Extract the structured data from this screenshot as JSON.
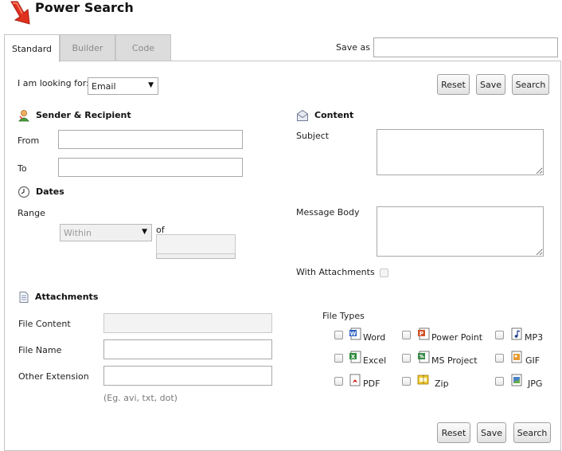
{
  "header": {
    "title": "Power Search"
  },
  "tabs": [
    {
      "label": "Standard",
      "active": true
    },
    {
      "label": "Builder",
      "active": false
    },
    {
      "label": "Code",
      "active": false
    }
  ],
  "save_as": {
    "label": "Save as",
    "value": ""
  },
  "looking_for": {
    "label": "I am looking for:",
    "selected": "Email"
  },
  "buttons": {
    "reset": "Reset",
    "save": "Save",
    "search": "Search"
  },
  "sender": {
    "title": "Sender & Recipient",
    "from_label": "From",
    "to_label": "To",
    "from_value": "",
    "to_value": ""
  },
  "dates": {
    "title": "Dates",
    "range_label": "Range",
    "range_selected": "Within",
    "unit_selected": "",
    "of_label": "of",
    "of_value": ""
  },
  "content": {
    "title": "Content",
    "subject_label": "Subject",
    "body_label": "Message Body",
    "attachments_label": "With Attachments"
  },
  "attachments": {
    "title": "Attachments",
    "file_content_label": "File Content",
    "file_name_label": "File Name",
    "other_ext_label": "Other Extension",
    "hint": "(Eg. avi, txt, dot)"
  },
  "file_types": {
    "title": "File Types",
    "items": [
      {
        "label": "Word",
        "icon": "word-icon"
      },
      {
        "label": "Power Point",
        "icon": "powerpoint-icon"
      },
      {
        "label": "MP3",
        "icon": "mp3-icon"
      },
      {
        "label": "Excel",
        "icon": "excel-icon"
      },
      {
        "label": "MS Project",
        "icon": "msproject-icon"
      },
      {
        "label": "GIF",
        "icon": "gif-icon"
      },
      {
        "label": "PDF",
        "icon": "pdf-icon"
      },
      {
        "label": "Zip",
        "icon": "zip-icon"
      },
      {
        "label": "JPG",
        "icon": "jpg-icon"
      }
    ]
  },
  "colors": {
    "accent_red": "#e0301e",
    "panel_border": "#c4c4c4",
    "tab_inactive": "#dcdcdc"
  }
}
